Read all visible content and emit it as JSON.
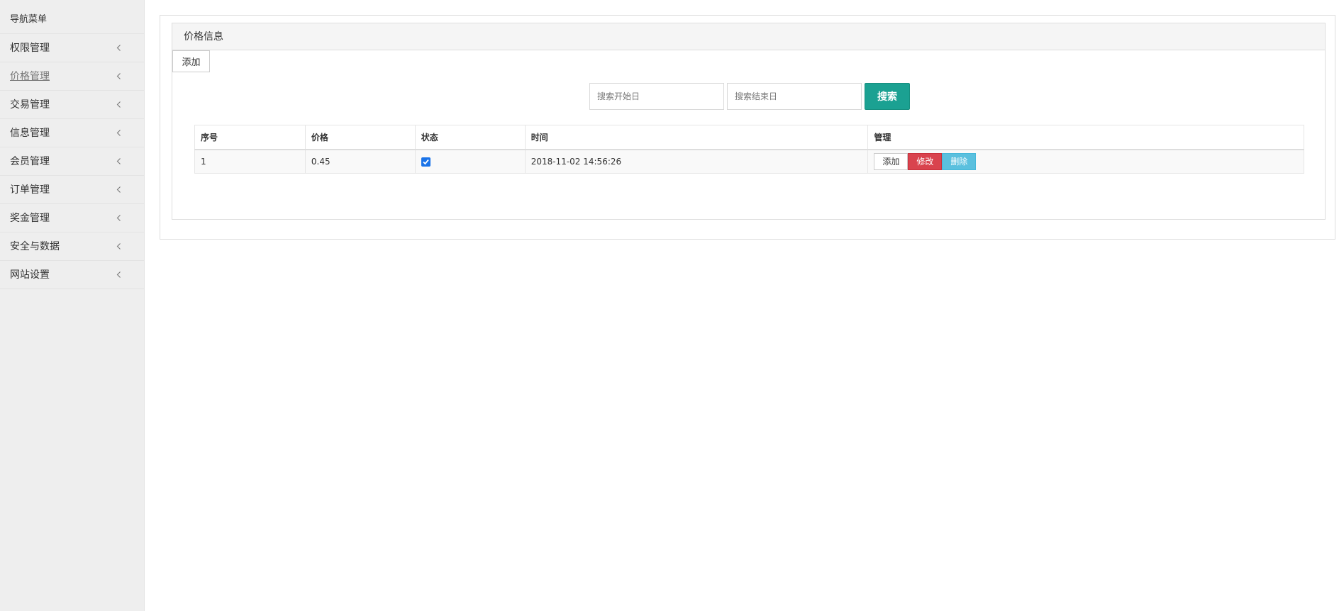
{
  "sidebar": {
    "title": "导航菜单",
    "items": [
      {
        "label": "权限管理"
      },
      {
        "label": "价格管理"
      },
      {
        "label": "交易管理"
      },
      {
        "label": "信息管理"
      },
      {
        "label": "会员管理"
      },
      {
        "label": "订单管理"
      },
      {
        "label": "奖金管理"
      },
      {
        "label": "安全与数据"
      },
      {
        "label": "网站设置"
      }
    ]
  },
  "panel": {
    "title": "价格信息",
    "add_label": "添加"
  },
  "search": {
    "start_placeholder": "搜索开始日",
    "end_placeholder": "搜索结束日",
    "button_label": "搜索"
  },
  "table": {
    "headers": [
      "序号",
      "价格",
      "状态",
      "时间",
      "管理"
    ],
    "rows": [
      {
        "id": "1",
        "price": "0.45",
        "status_checked": true,
        "time": "2018-11-02 14:56:26",
        "actions": {
          "add": "添加",
          "edit": "修改",
          "delete": "删除"
        }
      }
    ]
  },
  "colors": {
    "search_button": "#1ba192",
    "edit_button": "#d9434e",
    "delete_button": "#5bc0de",
    "sidebar_bg": "#eeeeee"
  },
  "icons": {
    "menu_chevron": "chevron-left-icon",
    "status": "checkbox-checked-icon"
  }
}
